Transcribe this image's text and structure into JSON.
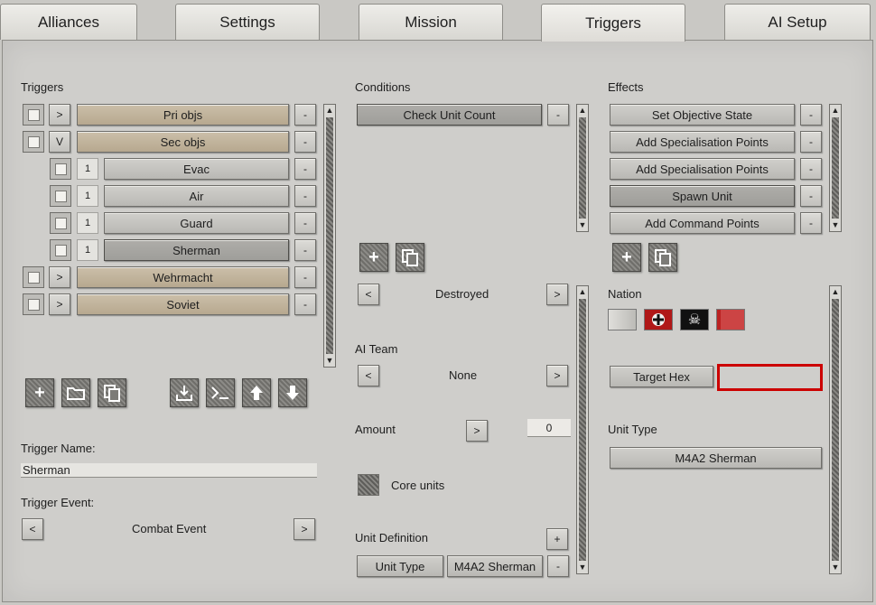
{
  "tabs": [
    "Alliances",
    "Settings",
    "Mission",
    "Triggers",
    "AI Setup"
  ],
  "triggers": {
    "heading": "Triggers",
    "rows": [
      {
        "toggle": ">",
        "label": "Pri objs"
      },
      {
        "toggle": "V",
        "label": "Sec objs"
      },
      {
        "count": "1",
        "label": "Evac"
      },
      {
        "count": "1",
        "label": "Air"
      },
      {
        "count": "1",
        "label": "Guard"
      },
      {
        "count": "1",
        "label": "Sherman"
      },
      {
        "toggle": ">",
        "label": "Wehrmacht"
      },
      {
        "toggle": ">",
        "label": "Soviet"
      }
    ],
    "remove_label": "-",
    "name_label": "Trigger Name:",
    "name_value": "Sherman",
    "event_label": "Trigger Event:",
    "event_value": "Combat Event",
    "prev": "<",
    "next": ">"
  },
  "conditions": {
    "heading": "Conditions",
    "items": [
      "Check Unit Count"
    ],
    "remove_label": "-",
    "state_value": "Destroyed",
    "ai_team_label": "AI Team",
    "ai_team_value": "None",
    "amount_label": "Amount",
    "amount_button": ">",
    "amount_value": "0",
    "core_units_label": "Core units",
    "unit_def_label": "Unit Definition",
    "unit_def_add": "+",
    "unit_type_btn": "Unit Type",
    "unit_type_value": "M4A2 Sherman",
    "prev": "<",
    "next": ">"
  },
  "effects": {
    "heading": "Effects",
    "items": [
      "Set Objective State",
      "Add Specialisation Points",
      "Add Specialisation Points",
      "Spawn Unit",
      "Add Command Points"
    ],
    "remove_label": "-",
    "nation_label": "Nation",
    "target_hex_label": "Target Hex",
    "target_hex_value": "",
    "unit_type_label": "Unit Type",
    "unit_type_value": "M4A2 Sherman"
  },
  "scroll_up": "▲",
  "scroll_down": "▼",
  "colors": {
    "highlight": "#cc0000",
    "tan_button": "#c3b59c"
  }
}
